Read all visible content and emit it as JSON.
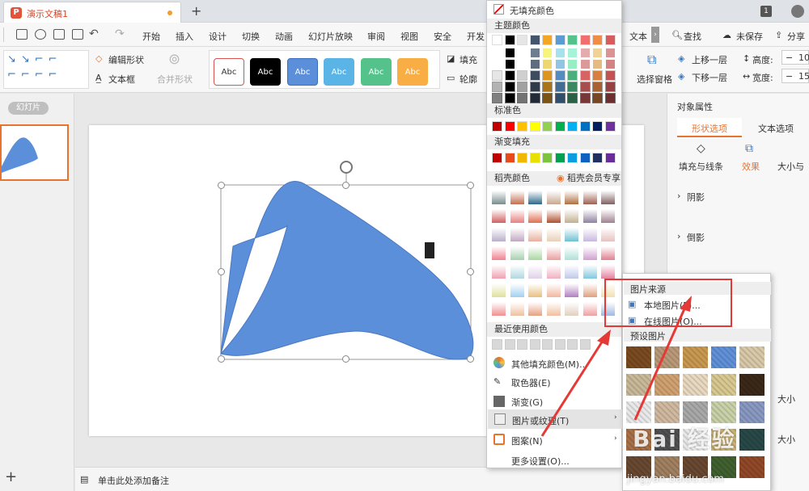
{
  "titlebar": {
    "doc_name": "演示文稿1",
    "badge": "1"
  },
  "menu": {
    "items": [
      "开始",
      "插入",
      "设计",
      "切换",
      "动画",
      "幻灯片放映",
      "审阅",
      "视图",
      "安全",
      "开发"
    ],
    "text_tab": "文本",
    "search": "查找",
    "save_status": "未保存",
    "share": "分享"
  },
  "ribbon": {
    "edit_shape": "编辑形状",
    "textbox": "文本框",
    "merge_shape": "合并形状",
    "style_label": "Abc",
    "styles": [
      {
        "bg": "#ffffff",
        "fg": "#333333",
        "border": "#d9534f"
      },
      {
        "bg": "#000000",
        "fg": "#ffffff",
        "border": "#000000"
      },
      {
        "bg": "#5b8fd9",
        "fg": "#ffffff",
        "border": "#3b6fb9"
      },
      {
        "bg": "#5ab4e5",
        "fg": "#ffffff",
        "border": "#5ab4e5"
      },
      {
        "bg": "#55c18b",
        "fg": "#ffffff",
        "border": "#55c18b"
      },
      {
        "bg": "#f8ae45",
        "fg": "#ffffff",
        "border": "#f8ae45"
      }
    ],
    "fill": "填充",
    "outline": "轮廓",
    "select_pane": "选择窗格",
    "bring_forward": "上移一层",
    "send_backward": "下移一层",
    "height_label": "高度:",
    "width_label": "宽度:",
    "height_value": "10",
    "width_value": "15"
  },
  "left_panel": {
    "tab": "幻灯片"
  },
  "notes": {
    "placeholder": "单击此处添加备注"
  },
  "right_panel": {
    "title": "对象属性",
    "tabs": [
      "形状选项",
      "文本选项"
    ],
    "subtabs": [
      "填充与线条",
      "效果",
      "大小与"
    ],
    "rows": [
      "阴影",
      "倒影"
    ],
    "size_label": "大小"
  },
  "color_menu": {
    "no_fill": "无填充颜色",
    "theme_colors": "主题颜色",
    "standard_colors": "标准色",
    "gradient_fill": "渐变填充",
    "daoke_colors": "稻壳颜色",
    "daoke_member": "稻壳会员专享",
    "recent_colors": "最近使用颜色",
    "more_colors": "其他填充颜色(M)...",
    "eyedropper": "取色器(E)",
    "gradient": "渐变(G)",
    "picture_texture": "图片或纹理(T)",
    "pattern": "图案(N)",
    "more_settings": "更多设置(O)...",
    "theme_row": [
      "#ffffff",
      "#000000",
      "#e7e6e6",
      "#44546a",
      "#f5a623",
      "#5b9bd5",
      "#55c18b",
      "#f06e6e",
      "#f08c46",
      "#d85c5c"
    ],
    "standard_row": [
      "#c00000",
      "#ff0000",
      "#ffc000",
      "#ffff00",
      "#92d050",
      "#00b050",
      "#00b0f0",
      "#0070c0",
      "#002060",
      "#7030a0"
    ],
    "gradient_row": [
      "#c00000",
      "#e84a1a",
      "#f0b800",
      "#e8e000",
      "#7cc440",
      "#00a050",
      "#0a9ee0",
      "#1060c0",
      "#203060",
      "#6a2c9a"
    ]
  },
  "picture_menu": {
    "source_title": "图片来源",
    "local_picture": "本地图片(P)...",
    "online_picture": "在线图片(O)...",
    "preset_title": "预设图片",
    "textures": [
      "#7a4a20",
      "#b89878",
      "#c89850",
      "#6090d8",
      "#d8c8a8",
      "#c8b898",
      "#d0a070",
      "#e8d8c0",
      "#d8c890",
      "#3a2818",
      "#e8e8e8",
      "#d0b8a0",
      "#a8a8a8",
      "#c8d0a8",
      "#8898c0",
      "#a87048",
      "#505050",
      "#e8e8e8",
      "#c8b070",
      "#284848",
      "#684830",
      "#a08060",
      "#684830",
      "#406030",
      "#904828"
    ]
  },
  "watermark": {
    "text": "Bai 经验",
    "url": "jingyan.baidu.com"
  }
}
